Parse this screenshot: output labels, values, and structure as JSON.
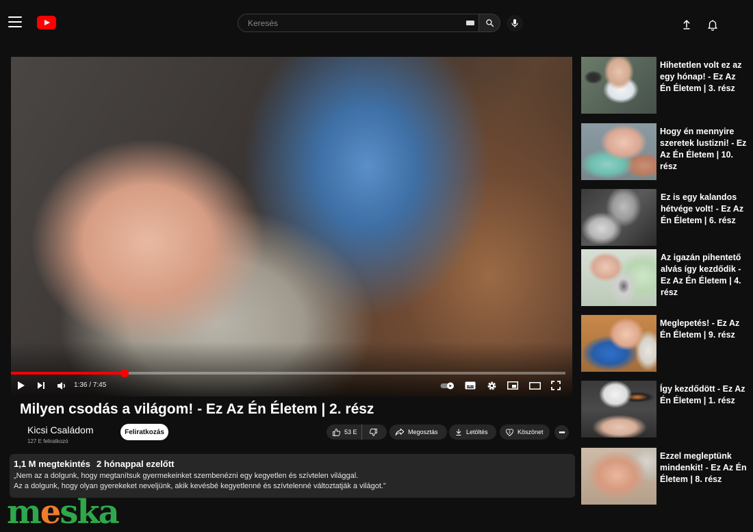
{
  "header": {
    "search_placeholder": "Keresés",
    "brand_color": "#ff0000"
  },
  "player": {
    "time": "1:36 / 7:45",
    "progress": 0.2065
  },
  "video": {
    "title": "Milyen csodás a világom! - Ez Az Én Életem | 2. rész",
    "channel": "Kicsi Családom",
    "subscribers": "127 E feliratkozó",
    "subscribe_label": "Feliratkozás",
    "likes": "53 E",
    "share_label": "Megosztás",
    "download_label": "Letöltés",
    "thanks_label": "Köszönet",
    "views": "1,1 M megtekintés",
    "date": "2 hónappal ezelőtt",
    "description_line1": "„Nem az a dolgunk, hogy megtanítsuk gyermekeinket szembenézni egy kegyetlen és szívtelen világgal.",
    "description_line2": "Az a dolgunk, hogy olyan gyerekeket neveljünk, akik kevésbé kegyetlenné és szívtelenné változtatják a világot.”"
  },
  "recommendations": [
    {
      "title": "Hihetetlen volt ez az egy hónap! - Ez Az Én Életem | 3. rész"
    },
    {
      "title": "Hogy én mennyire szeretek lustizni! - Ez Az Én Életem | 10. rész"
    },
    {
      "title": "Ez is egy kalandos hétvége volt! - Ez Az Én Életem | 6. rész"
    },
    {
      "title": "Az igazán pihentető alvás így kezdődik - Ez Az Én Életem | 4. rész"
    },
    {
      "title": "Meglepetés! - Ez Az Én Életem | 9. rész"
    },
    {
      "title": "Így kezdődött - Ez Az Én Életem | 1. rész"
    },
    {
      "title": "Ezzel megleptünk mindenkit! - Ez Az Én Életem | 8. rész"
    }
  ],
  "watermark": {
    "text_start": "m",
    "text_e": "e",
    "text_s": "s",
    "text_k": "k",
    "text_a": "a"
  }
}
